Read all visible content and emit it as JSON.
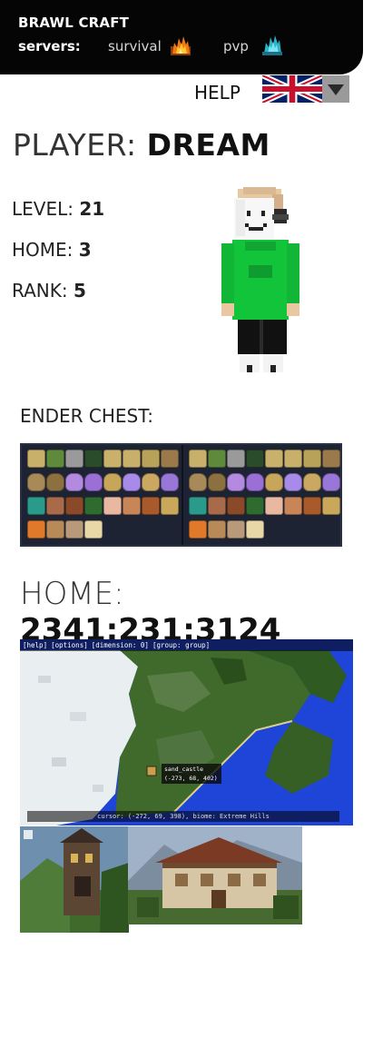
{
  "header": {
    "brand": "BRAWL CRAFT",
    "servers_label": "servers:",
    "servers": [
      {
        "label": "survival",
        "icon": "fire-icon"
      },
      {
        "label": "pvp",
        "icon": "diamond-icon"
      }
    ]
  },
  "help": {
    "label": "HELP",
    "language_icon": "uk-flag-icon",
    "dropdown_icon": "chevron-down-icon"
  },
  "player": {
    "title_prefix": "PLAYER: ",
    "name": "DREAM",
    "stats": [
      {
        "label": "LEVEL: ",
        "value": "21"
      },
      {
        "label": "HOME: ",
        "value": "3"
      },
      {
        "label": "RANK: ",
        "value": "5"
      }
    ]
  },
  "ender_chest": {
    "label": "ENDER CHEST:"
  },
  "home": {
    "title_prefix": "HOME: ",
    "coords": "2341:231:3124"
  },
  "map": {
    "bar_items": [
      "[help]",
      "[options]",
      "[dimension: 0]",
      "[group: group]"
    ],
    "marker_name": "sand_castle",
    "marker_coords": "(-273, 68, 402)",
    "cursor_text": "cursor: (-272, 69, 398), biome: Extreme Hills"
  },
  "colors": {
    "topbar": "#050505",
    "accent_green": "#12c43a",
    "ocean": "#1d3fd6"
  }
}
